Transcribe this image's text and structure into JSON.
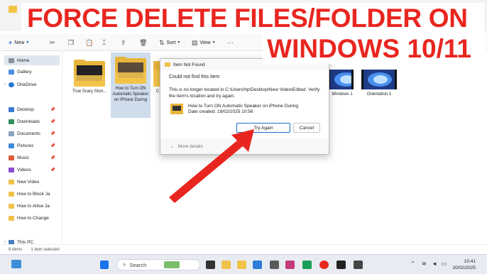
{
  "banner": {
    "line1": "FORCE DELETE FILES/FOLDER ON",
    "line2": "WINDOWS 10/11",
    "color": "#e8261f"
  },
  "toolbar": {
    "new_label": "New",
    "sort_label": "Sort",
    "view_label": "View",
    "more_label": "···"
  },
  "sidebar": {
    "items": [
      {
        "label": "Home",
        "icon": "home-icon"
      },
      {
        "label": "Gallery",
        "icon": "gallery-icon"
      },
      {
        "label": "OneDrive",
        "icon": "onedrive-icon"
      },
      {
        "label": "Desktop",
        "icon": "desktop-icon"
      },
      {
        "label": "Downloads",
        "icon": "downloads-icon"
      },
      {
        "label": "Documents",
        "icon": "documents-icon"
      },
      {
        "label": "Pictures",
        "icon": "pictures-icon"
      },
      {
        "label": "Music",
        "icon": "music-icon"
      },
      {
        "label": "Videos",
        "icon": "videos-icon"
      },
      {
        "label": "New Video",
        "icon": "folder-icon"
      },
      {
        "label": "How to Block Ja",
        "icon": "folder-icon"
      },
      {
        "label": "How to Allow Ja",
        "icon": "folder-icon"
      },
      {
        "label": "How to Change",
        "icon": "folder-icon"
      },
      {
        "label": "This PC",
        "icon": "pc-icon"
      }
    ]
  },
  "files": [
    {
      "name": "True Scary Stori..."
    },
    {
      "name": "How to Turn ON Automatic Speaker on iPhone During"
    },
    {
      "name": "C"
    },
    {
      "name": "Windows 1"
    },
    {
      "name": "Orientation 1"
    }
  ],
  "status": {
    "count": "8 items",
    "selected": "1 item selected"
  },
  "dialog": {
    "title": "Item Not Found",
    "heading": "Could not find this item",
    "message": "This is no longer located in C:\\Users\\hp\\Desktop\\New Video\\Edited. Verify the item's location and try again.",
    "item_name": "How to Turn ON Automatic Speaker on iPhone During",
    "item_date": "Date created: 19/02/2025 10:56",
    "try_again": "Try Again",
    "cancel": "Cancel",
    "more_details": "More details"
  },
  "taskbar": {
    "search": "Search",
    "time": "10:41",
    "date": "20/02/2025"
  }
}
